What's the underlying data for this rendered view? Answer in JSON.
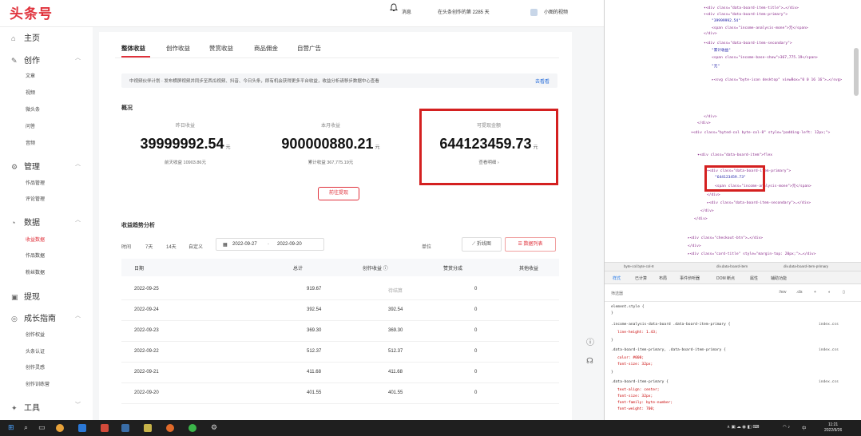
{
  "app": {
    "logo": "头条号",
    "header": {
      "notice": "消息",
      "days": "在头条创作的第 2285 天",
      "user": "小图的视频"
    },
    "sidebar": {
      "sections": [
        {
          "label": "主页",
          "icon": "home-icon"
        },
        {
          "label": "创作",
          "icon": "pen-icon",
          "items": [
            "文章",
            "视频",
            "微头条",
            "问答",
            "音频"
          ]
        },
        {
          "label": "管理",
          "icon": "gear-icon",
          "items": [
            "作品管理",
            "评论管理"
          ]
        },
        {
          "label": "数据",
          "icon": "chart-icon",
          "items": [
            "收益数据",
            "作品数据",
            "粉丝数据"
          ]
        },
        {
          "label": "提现",
          "icon": "wallet-icon"
        },
        {
          "label": "成长指南",
          "icon": "compass-icon",
          "items": [
            "创作权益",
            "头条认证",
            "创作灵感",
            "创作训练营"
          ]
        },
        {
          "label": "工具",
          "icon": "tool-icon"
        }
      ]
    },
    "tabs": [
      "整体收益",
      "创作收益",
      "赞赏收益",
      "商品佣金",
      "自营广告"
    ],
    "banner": {
      "text": "中视频伙伴计划 · 发布横屏视频并同步至西瓜视频、抖音、今日头条，即有机会获得更多平台收益，收益分析请移步数据中心查看",
      "link": "去看看"
    },
    "overview": {
      "title": "概况",
      "stats": [
        {
          "label": "昨日收益",
          "value": "39999992.54",
          "unit": "元",
          "sub": "前天收益 10903.86元"
        },
        {
          "label": "本月收益",
          "value": "900000880.21",
          "unit": "元",
          "sub": "累计收益 367,775.19元"
        },
        {
          "label": "可提现金额",
          "value": "644123459.73",
          "unit": "元",
          "sub": "查看明细 ›"
        }
      ],
      "withdraw_button": "前往提现"
    },
    "trend": {
      "title": "收益趋势分析",
      "ranges": [
        "时间",
        "7天",
        "14天",
        "自定义"
      ],
      "start_date": "2022-09-27",
      "end_date": "2022-09-20",
      "unit_label": "单位",
      "chart_button": "折线图",
      "table_button": "数据列表",
      "columns": [
        "日期",
        "总计",
        "创作收益",
        "赞赏分成",
        "其他收益"
      ],
      "rows": [
        [
          "2022-09-25",
          "919.67",
          "待结算",
          "0"
        ],
        [
          "2022-09-24",
          "392.54",
          "392.54",
          "0"
        ],
        [
          "2022-09-23",
          "369.30",
          "369.30",
          "0"
        ],
        [
          "2022-09-22",
          "512.37",
          "512.37",
          "0"
        ],
        [
          "2022-09-21",
          "411.68",
          "411.68",
          "0"
        ],
        [
          "2022-09-20",
          "401.55",
          "401.55",
          "0"
        ]
      ]
    }
  },
  "devtools": {
    "code_lines": [
      "▾<div class=\"data-board-item-title\">…</div>",
      "▾<div class=\"data-board-item-primary\">",
      "\"39999992.54\"",
      "<span class=\"income-analysis-mone\">元</span>",
      "</div>",
      "▾<div class=\"data-board-item-secondary\">",
      "\"累计收益\"",
      "<span class=\"income-base-show\">367,775.19</span>",
      "\"元\"",
      "▸<svg class=\"byte-icon desktop\" viewBox=\"0 0 16 16\">…</svg>",
      "</div>",
      "</div>",
      "▾<div class=\"byted-col byte-col-8\" style=\"padding-left: 12px;\">",
      "▾<div class=\"data-board-item\">flex",
      "▾<div class=\"data-board-item-primary\">",
      "\"644123459.73\"",
      "<span class=\"income-analysis-mone\">元</span>",
      "</div>",
      "▸<div class=\"data-board-item-secondary\">…</div>",
      "</div>",
      "</div>",
      "▸<div class=\"checkout-btn\">…</div>",
      "</div>",
      "▸<div class=\"card-title\" style=\"margin-top: 20px;\">…</div>"
    ],
    "breadcrumb": [
      "byte-col.byte-col-8",
      "div.data-board-item",
      "div.data-board-item-primary"
    ],
    "tabs": [
      "样式",
      "已计算",
      "布局",
      "事件侦听器",
      "DOM 断点",
      "属性",
      "辅助功能"
    ],
    "filter_placeholder": "筛选器",
    "filter_right": [
      ":hov",
      ".cls",
      "+"
    ],
    "style_lines": [
      {
        "text": "element.style {",
        "kind": "t"
      },
      {
        "text": "}",
        "kind": "t"
      },
      {
        "text": ".income-analysis-data-board .data-board-item-primary {",
        "kind": "t",
        "src": "index.css"
      },
      {
        "text": "line-height: 1.43;",
        "kind": "p"
      },
      {
        "text": "}",
        "kind": "t"
      },
      {
        "text": ".data-board-item-primary, .data-board-item-primary {",
        "kind": "t",
        "src": "index.css"
      },
      {
        "text": "color: #000;",
        "kind": "p"
      },
      {
        "text": "font-size: 32px;",
        "kind": "p"
      },
      {
        "text": "}",
        "kind": "t"
      },
      {
        "text": ".data-board-item-primary {",
        "kind": "t",
        "src": "index.css"
      },
      {
        "text": "text-align: center;",
        "kind": "p"
      },
      {
        "text": "font-size: 32px;",
        "kind": "p"
      },
      {
        "text": "font-family: byte-number;",
        "kind": "p"
      },
      {
        "text": "font-weight: 700;",
        "kind": "p"
      }
    ]
  },
  "taskbar": {
    "tray_lang": "中",
    "time": "11:21",
    "date": "2022/9/26"
  }
}
